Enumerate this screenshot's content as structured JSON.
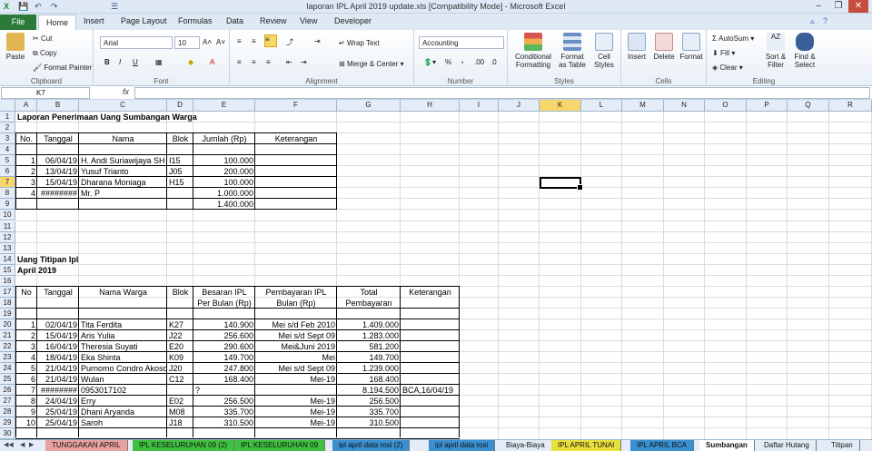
{
  "window": {
    "title": "laporan IPL April 2019 update.xls  [Compatibility Mode]  -  Microsoft Excel",
    "controls": [
      "–",
      "❐",
      "✕"
    ]
  },
  "quick_access": [
    "💾",
    "↶",
    "↷",
    "☰"
  ],
  "tabs": {
    "file": "File",
    "items": [
      "Home",
      "Insert",
      "Page Layout",
      "Formulas",
      "Data",
      "Review",
      "View",
      "Developer"
    ]
  },
  "ribbon": {
    "clipboard": {
      "name": "Clipboard",
      "paste": "Paste",
      "cut": "Cut",
      "copy": "Copy",
      "format_painter": "Format Painter"
    },
    "font": {
      "name": "Font",
      "family": "Arial",
      "size": "10",
      "bold": "B",
      "italic": "I",
      "underline": "U"
    },
    "alignment": {
      "name": "Alignment",
      "wrap": "Wrap Text",
      "merge": "Merge & Center"
    },
    "number": {
      "name": "Number",
      "format": "Accounting",
      "percent": "%",
      "comma": ",",
      "dec_inc": ".00",
      "dec_dec": ".0"
    },
    "styles": {
      "name": "Styles",
      "conditional": "Conditional Formatting",
      "format_table": "Format as Table",
      "cell_styles": "Cell Styles"
    },
    "cells": {
      "name": "Cells",
      "insert": "Insert",
      "delete": "Delete",
      "format": "Format"
    },
    "editing": {
      "name": "Editing",
      "autosum": "AutoSum",
      "fill": "Fill",
      "clear": "Clear",
      "sort": "Sort & Filter",
      "find": "Find & Select"
    }
  },
  "formula_bar": {
    "name_box": "K7",
    "fx": "fx",
    "value": ""
  },
  "columns": [
    "A",
    "B",
    "C",
    "D",
    "E",
    "F",
    "G",
    "H",
    "I",
    "J",
    "K",
    "L",
    "M",
    "N",
    "O",
    "P",
    "Q",
    "R"
  ],
  "rows": [
    "1",
    "2",
    "3",
    "4",
    "5",
    "6",
    "7",
    "8",
    "9",
    "10",
    "11",
    "12",
    "13",
    "14",
    "15",
    "16",
    "17",
    "18",
    "19",
    "20",
    "21",
    "22",
    "23",
    "24",
    "25",
    "26",
    "27",
    "28",
    "29",
    "30"
  ],
  "section1": {
    "title": "Laporan Penerimaan Uang Sumbangan Warga",
    "headers": [
      "No.",
      "Tanggal",
      "Nama",
      "Blok",
      "Jumlah (Rp)",
      "Keterangan"
    ],
    "rows": [
      [
        "1",
        "06/04/19",
        "H. Andi Suriawijaya SH",
        "I15",
        "100.000",
        ""
      ],
      [
        "2",
        "13/04/19",
        "Yusuf Trianto",
        "J05",
        "200.000",
        ""
      ],
      [
        "3",
        "15/04/19",
        "Dharana Moniaga",
        "H15",
        "100.000",
        ""
      ],
      [
        "4",
        "########",
        "Mr. P",
        "",
        "1.000.000",
        ""
      ]
    ],
    "total": "1.400.000"
  },
  "section2": {
    "title": "Uang Titipan Ipl",
    "subtitle": "April 2019",
    "headers": [
      "No",
      "Tanggal",
      "Nama Warga",
      "Blok",
      "Besaran IPL",
      "Pembayaran IPL",
      "Total",
      "Keterangan"
    ],
    "headers2": [
      "",
      "",
      "",
      "",
      "Per Bulan (Rp)",
      "Bulan (Rp)",
      "Pembayaran",
      ""
    ],
    "rows": [
      [
        "1",
        "02/04/19",
        "Tita Ferdita",
        "K27",
        "140.900",
        "Mei s/d Feb 2010",
        "1.409.000",
        ""
      ],
      [
        "2",
        "15/04/19",
        "Aris Yulia",
        "J22",
        "256.600",
        "Mei s/d Sept 09",
        "1.283.000",
        ""
      ],
      [
        "3",
        "16/04/19",
        "Theresia Suyati",
        "E20",
        "290.600",
        "Mei&Juni 2019",
        "581.200",
        ""
      ],
      [
        "4",
        "18/04/19",
        "Eka Shinta",
        "K09",
        "149.700",
        "Mei",
        "149.700",
        ""
      ],
      [
        "5",
        "21/04/19",
        "Purnomo Condro Akoso",
        "J20",
        "247.800",
        "Mei s/d Sept 09",
        "1.239.000",
        ""
      ],
      [
        "6",
        "21/04/19",
        "Wulan",
        "C12",
        "168.400",
        "Mei-19",
        "168.400",
        ""
      ],
      [
        "7",
        "########",
        "0953017102",
        "",
        "?",
        "",
        "8.194.500",
        "BCA,16/04/19"
      ],
      [
        "8",
        "24/04/19",
        "Erry",
        "E02",
        "256.500",
        "Mei-19",
        "256.500",
        ""
      ],
      [
        "9",
        "25/04/19",
        "Dhani Aryanda",
        "M08",
        "335.700",
        "Mei-19",
        "335.700",
        ""
      ],
      [
        "10",
        "25/04/19",
        "Saroh",
        "J18",
        "310.500",
        "Mei-19",
        "310.500",
        ""
      ]
    ]
  },
  "sheets": [
    {
      "name": "TUNGGAKAN APRIL",
      "color": "#e8a0a0"
    },
    {
      "name": "IPL KESELURUHAN 09 (2)",
      "color": "#3fc03f"
    },
    {
      "name": "IPL KESELURUHAN 09",
      "color": "#3fc03f"
    },
    {
      "name": "ipl april data rosi (2)",
      "color": "#3a8fd0"
    },
    {
      "name": "ipl april data rosi",
      "color": "#3a8fd0"
    },
    {
      "name": "Biaya-Biaya",
      "color": "#e4ecf7"
    },
    {
      "name": "IPL APRIL TUNAI",
      "color": "#e8e03a"
    },
    {
      "name": "IPL APRIL BCA",
      "color": "#3a8fd0"
    },
    {
      "name": "Sumbangan",
      "color": "#ffffff"
    },
    {
      "name": "Daftar Hutang",
      "color": "#e4ecf7"
    },
    {
      "name": "Titipan",
      "color": "#e4ecf7"
    }
  ],
  "colors": {
    "file_tab": "#2a7a3a",
    "header_bg": "#e4ecf7",
    "active_col": "#f7d66b"
  }
}
